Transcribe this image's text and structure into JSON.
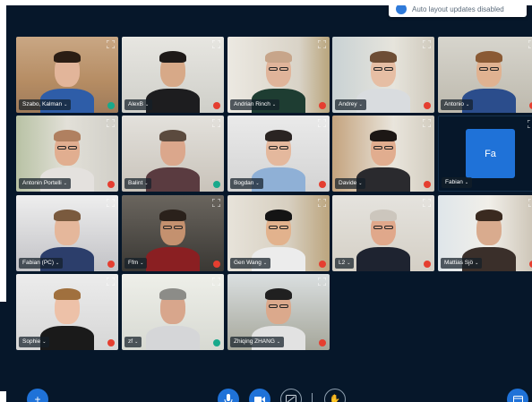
{
  "toast": {
    "text": "Auto layout updates disabled",
    "icon": "info-icon"
  },
  "participants": [
    {
      "name": "Szabo, Kalman",
      "mic": "on"
    },
    {
      "name": "AlexB",
      "mic": "muted"
    },
    {
      "name": "Andrian Rinch",
      "mic": "muted"
    },
    {
      "name": "Andrey",
      "mic": "muted"
    },
    {
      "name": "Antonio",
      "mic": "muted"
    },
    {
      "name": "Antonin Portelli",
      "mic": "muted"
    },
    {
      "name": "Balint",
      "mic": "on"
    },
    {
      "name": "Bogdan",
      "mic": "muted"
    },
    {
      "name": "Davide",
      "mic": "muted"
    },
    {
      "name": "Fabian",
      "mic": "none",
      "avatar": "Fa"
    },
    {
      "name": "Fabian (PC)",
      "mic": "muted"
    },
    {
      "name": "Ffm",
      "mic": "muted"
    },
    {
      "name": "Gen Wang",
      "mic": "muted"
    },
    {
      "name": "L2",
      "mic": "muted"
    },
    {
      "name": "Mattias Sjö",
      "mic": "muted"
    },
    {
      "name": "Sophie",
      "mic": "muted"
    },
    {
      "name": "zf",
      "mic": "on"
    },
    {
      "name": "Zhiqing ZHANG",
      "mic": "muted"
    }
  ],
  "toolbar": {
    "add": "+",
    "mic": "🎙",
    "camera": "■",
    "screen": "⧄",
    "raise_hand": "✋",
    "layout": "▭"
  },
  "colors": {
    "background": "#06172a",
    "accent": "#1f72d8",
    "muted": "#e53e30",
    "unmuted": "#18a98b"
  }
}
